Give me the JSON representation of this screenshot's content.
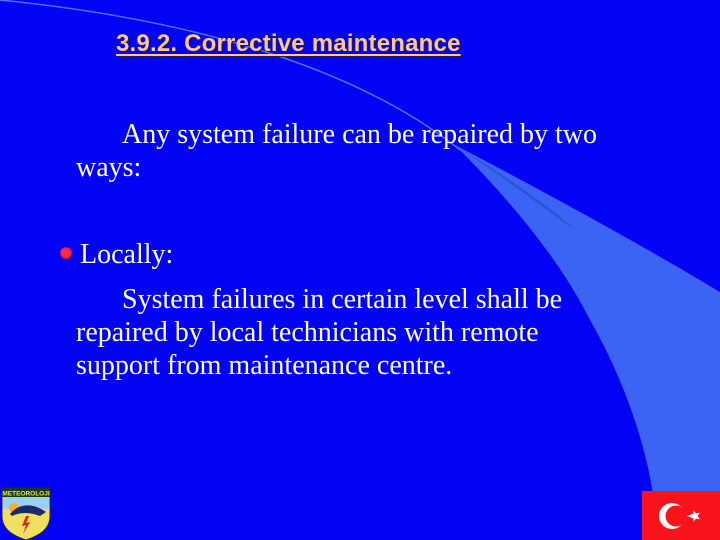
{
  "slide": {
    "title": "3.9.2. Corrective maintenance",
    "intro": {
      "line1": "Any system failure can be repaired by two",
      "line2": "ways:"
    },
    "bullets": [
      {
        "icon": "flower-bullet-icon",
        "heading": "Locally:",
        "body_lines": [
          "System failures in certain level shall be",
          [
            "repaired",
            "by",
            "local",
            "technicians",
            "with",
            "remote"
          ],
          "support from maintenance centre."
        ]
      }
    ],
    "logo": {
      "text": "METEOROLOJI",
      "icon": "meteorology-emblem-icon"
    },
    "flag": {
      "icon": "turkish-flag-icon"
    },
    "colors": {
      "background": "#0202f4",
      "title": "#fcc88c",
      "text": "#ffffff",
      "swoosh": "#3c64f4",
      "bullet": "#ff2a4a",
      "flag_red": "#f8141a"
    }
  }
}
